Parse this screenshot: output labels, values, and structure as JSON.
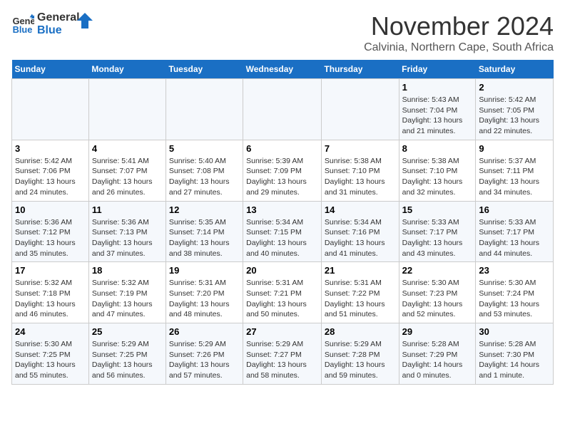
{
  "logo": {
    "line1": "General",
    "line2": "Blue"
  },
  "title": "November 2024",
  "location": "Calvinia, Northern Cape, South Africa",
  "weekdays": [
    "Sunday",
    "Monday",
    "Tuesday",
    "Wednesday",
    "Thursday",
    "Friday",
    "Saturday"
  ],
  "weeks": [
    [
      {
        "day": "",
        "info": ""
      },
      {
        "day": "",
        "info": ""
      },
      {
        "day": "",
        "info": ""
      },
      {
        "day": "",
        "info": ""
      },
      {
        "day": "",
        "info": ""
      },
      {
        "day": "1",
        "info": "Sunrise: 5:43 AM\nSunset: 7:04 PM\nDaylight: 13 hours and 21 minutes."
      },
      {
        "day": "2",
        "info": "Sunrise: 5:42 AM\nSunset: 7:05 PM\nDaylight: 13 hours and 22 minutes."
      }
    ],
    [
      {
        "day": "3",
        "info": "Sunrise: 5:42 AM\nSunset: 7:06 PM\nDaylight: 13 hours and 24 minutes."
      },
      {
        "day": "4",
        "info": "Sunrise: 5:41 AM\nSunset: 7:07 PM\nDaylight: 13 hours and 26 minutes."
      },
      {
        "day": "5",
        "info": "Sunrise: 5:40 AM\nSunset: 7:08 PM\nDaylight: 13 hours and 27 minutes."
      },
      {
        "day": "6",
        "info": "Sunrise: 5:39 AM\nSunset: 7:09 PM\nDaylight: 13 hours and 29 minutes."
      },
      {
        "day": "7",
        "info": "Sunrise: 5:38 AM\nSunset: 7:10 PM\nDaylight: 13 hours and 31 minutes."
      },
      {
        "day": "8",
        "info": "Sunrise: 5:38 AM\nSunset: 7:10 PM\nDaylight: 13 hours and 32 minutes."
      },
      {
        "day": "9",
        "info": "Sunrise: 5:37 AM\nSunset: 7:11 PM\nDaylight: 13 hours and 34 minutes."
      }
    ],
    [
      {
        "day": "10",
        "info": "Sunrise: 5:36 AM\nSunset: 7:12 PM\nDaylight: 13 hours and 35 minutes."
      },
      {
        "day": "11",
        "info": "Sunrise: 5:36 AM\nSunset: 7:13 PM\nDaylight: 13 hours and 37 minutes."
      },
      {
        "day": "12",
        "info": "Sunrise: 5:35 AM\nSunset: 7:14 PM\nDaylight: 13 hours and 38 minutes."
      },
      {
        "day": "13",
        "info": "Sunrise: 5:34 AM\nSunset: 7:15 PM\nDaylight: 13 hours and 40 minutes."
      },
      {
        "day": "14",
        "info": "Sunrise: 5:34 AM\nSunset: 7:16 PM\nDaylight: 13 hours and 41 minutes."
      },
      {
        "day": "15",
        "info": "Sunrise: 5:33 AM\nSunset: 7:17 PM\nDaylight: 13 hours and 43 minutes."
      },
      {
        "day": "16",
        "info": "Sunrise: 5:33 AM\nSunset: 7:17 PM\nDaylight: 13 hours and 44 minutes."
      }
    ],
    [
      {
        "day": "17",
        "info": "Sunrise: 5:32 AM\nSunset: 7:18 PM\nDaylight: 13 hours and 46 minutes."
      },
      {
        "day": "18",
        "info": "Sunrise: 5:32 AM\nSunset: 7:19 PM\nDaylight: 13 hours and 47 minutes."
      },
      {
        "day": "19",
        "info": "Sunrise: 5:31 AM\nSunset: 7:20 PM\nDaylight: 13 hours and 48 minutes."
      },
      {
        "day": "20",
        "info": "Sunrise: 5:31 AM\nSunset: 7:21 PM\nDaylight: 13 hours and 50 minutes."
      },
      {
        "day": "21",
        "info": "Sunrise: 5:31 AM\nSunset: 7:22 PM\nDaylight: 13 hours and 51 minutes."
      },
      {
        "day": "22",
        "info": "Sunrise: 5:30 AM\nSunset: 7:23 PM\nDaylight: 13 hours and 52 minutes."
      },
      {
        "day": "23",
        "info": "Sunrise: 5:30 AM\nSunset: 7:24 PM\nDaylight: 13 hours and 53 minutes."
      }
    ],
    [
      {
        "day": "24",
        "info": "Sunrise: 5:30 AM\nSunset: 7:25 PM\nDaylight: 13 hours and 55 minutes."
      },
      {
        "day": "25",
        "info": "Sunrise: 5:29 AM\nSunset: 7:25 PM\nDaylight: 13 hours and 56 minutes."
      },
      {
        "day": "26",
        "info": "Sunrise: 5:29 AM\nSunset: 7:26 PM\nDaylight: 13 hours and 57 minutes."
      },
      {
        "day": "27",
        "info": "Sunrise: 5:29 AM\nSunset: 7:27 PM\nDaylight: 13 hours and 58 minutes."
      },
      {
        "day": "28",
        "info": "Sunrise: 5:29 AM\nSunset: 7:28 PM\nDaylight: 13 hours and 59 minutes."
      },
      {
        "day": "29",
        "info": "Sunrise: 5:28 AM\nSunset: 7:29 PM\nDaylight: 14 hours and 0 minutes."
      },
      {
        "day": "30",
        "info": "Sunrise: 5:28 AM\nSunset: 7:30 PM\nDaylight: 14 hours and 1 minute."
      }
    ]
  ]
}
